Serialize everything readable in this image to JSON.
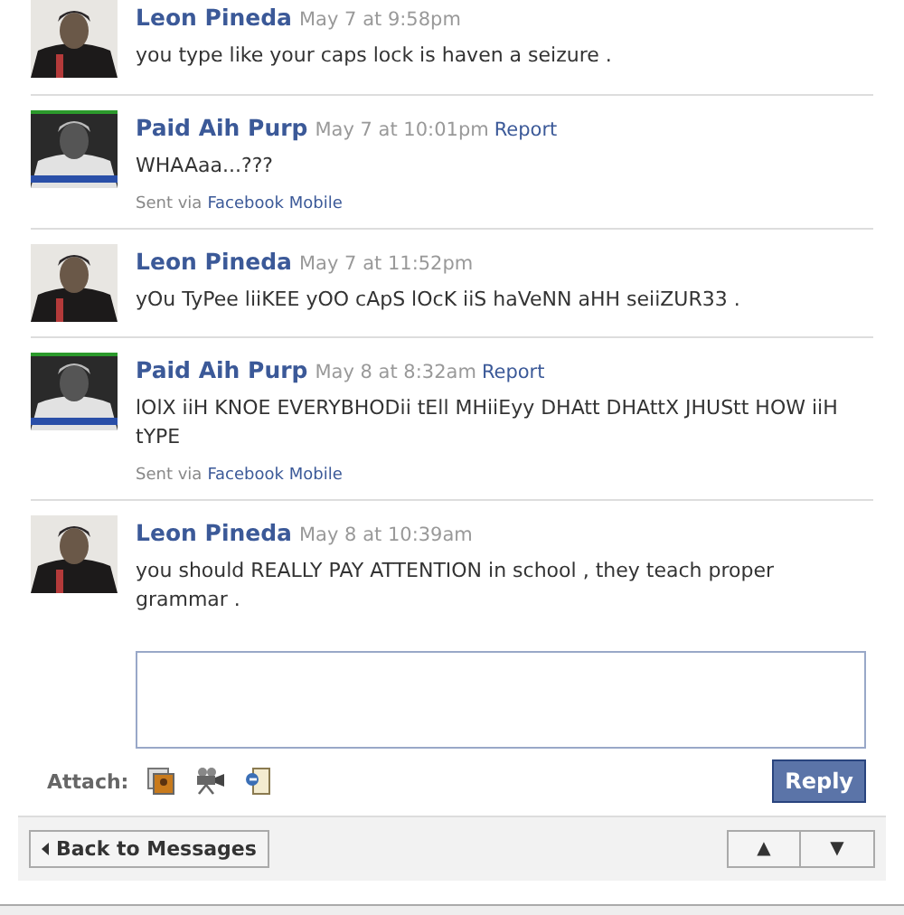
{
  "messages": [
    {
      "author": "Leon Pineda",
      "time": "May 7 at 9:58pm",
      "text": "you type like your caps lock is haven a seizure ."
    },
    {
      "author": "Paid Aih Purp",
      "time": "May 7 at 10:01pm",
      "report": "Report",
      "text": "WHAAaa...???",
      "sent_via": "Sent via",
      "via_link": "Facebook Mobile"
    },
    {
      "author": "Leon Pineda",
      "time": "May 7 at 11:52pm",
      "text": "yOu TyPee liiKEE yOO cApS lOcK iiS haVeNN aHH seiiZUR33 ."
    },
    {
      "author": "Paid Aih Purp",
      "time": "May 8 at 8:32am",
      "report": "Report",
      "text": "lOlX iiH KNOE EVERYBHODii tEll MHiiEyy DHAtt DHAttX JHUStt HOW iiH tYPE",
      "sent_via": "Sent via",
      "via_link": "Facebook Mobile"
    },
    {
      "author": "Leon Pineda",
      "time": "May 8 at 10:39am",
      "text": "you should REALLY PAY ATTENTION in school , they teach proper grammar ."
    }
  ],
  "reply": {
    "attach_label": "Attach:",
    "button": "Reply"
  },
  "footer": {
    "back": "Back to Messages",
    "up": "▲",
    "down": "▼"
  }
}
